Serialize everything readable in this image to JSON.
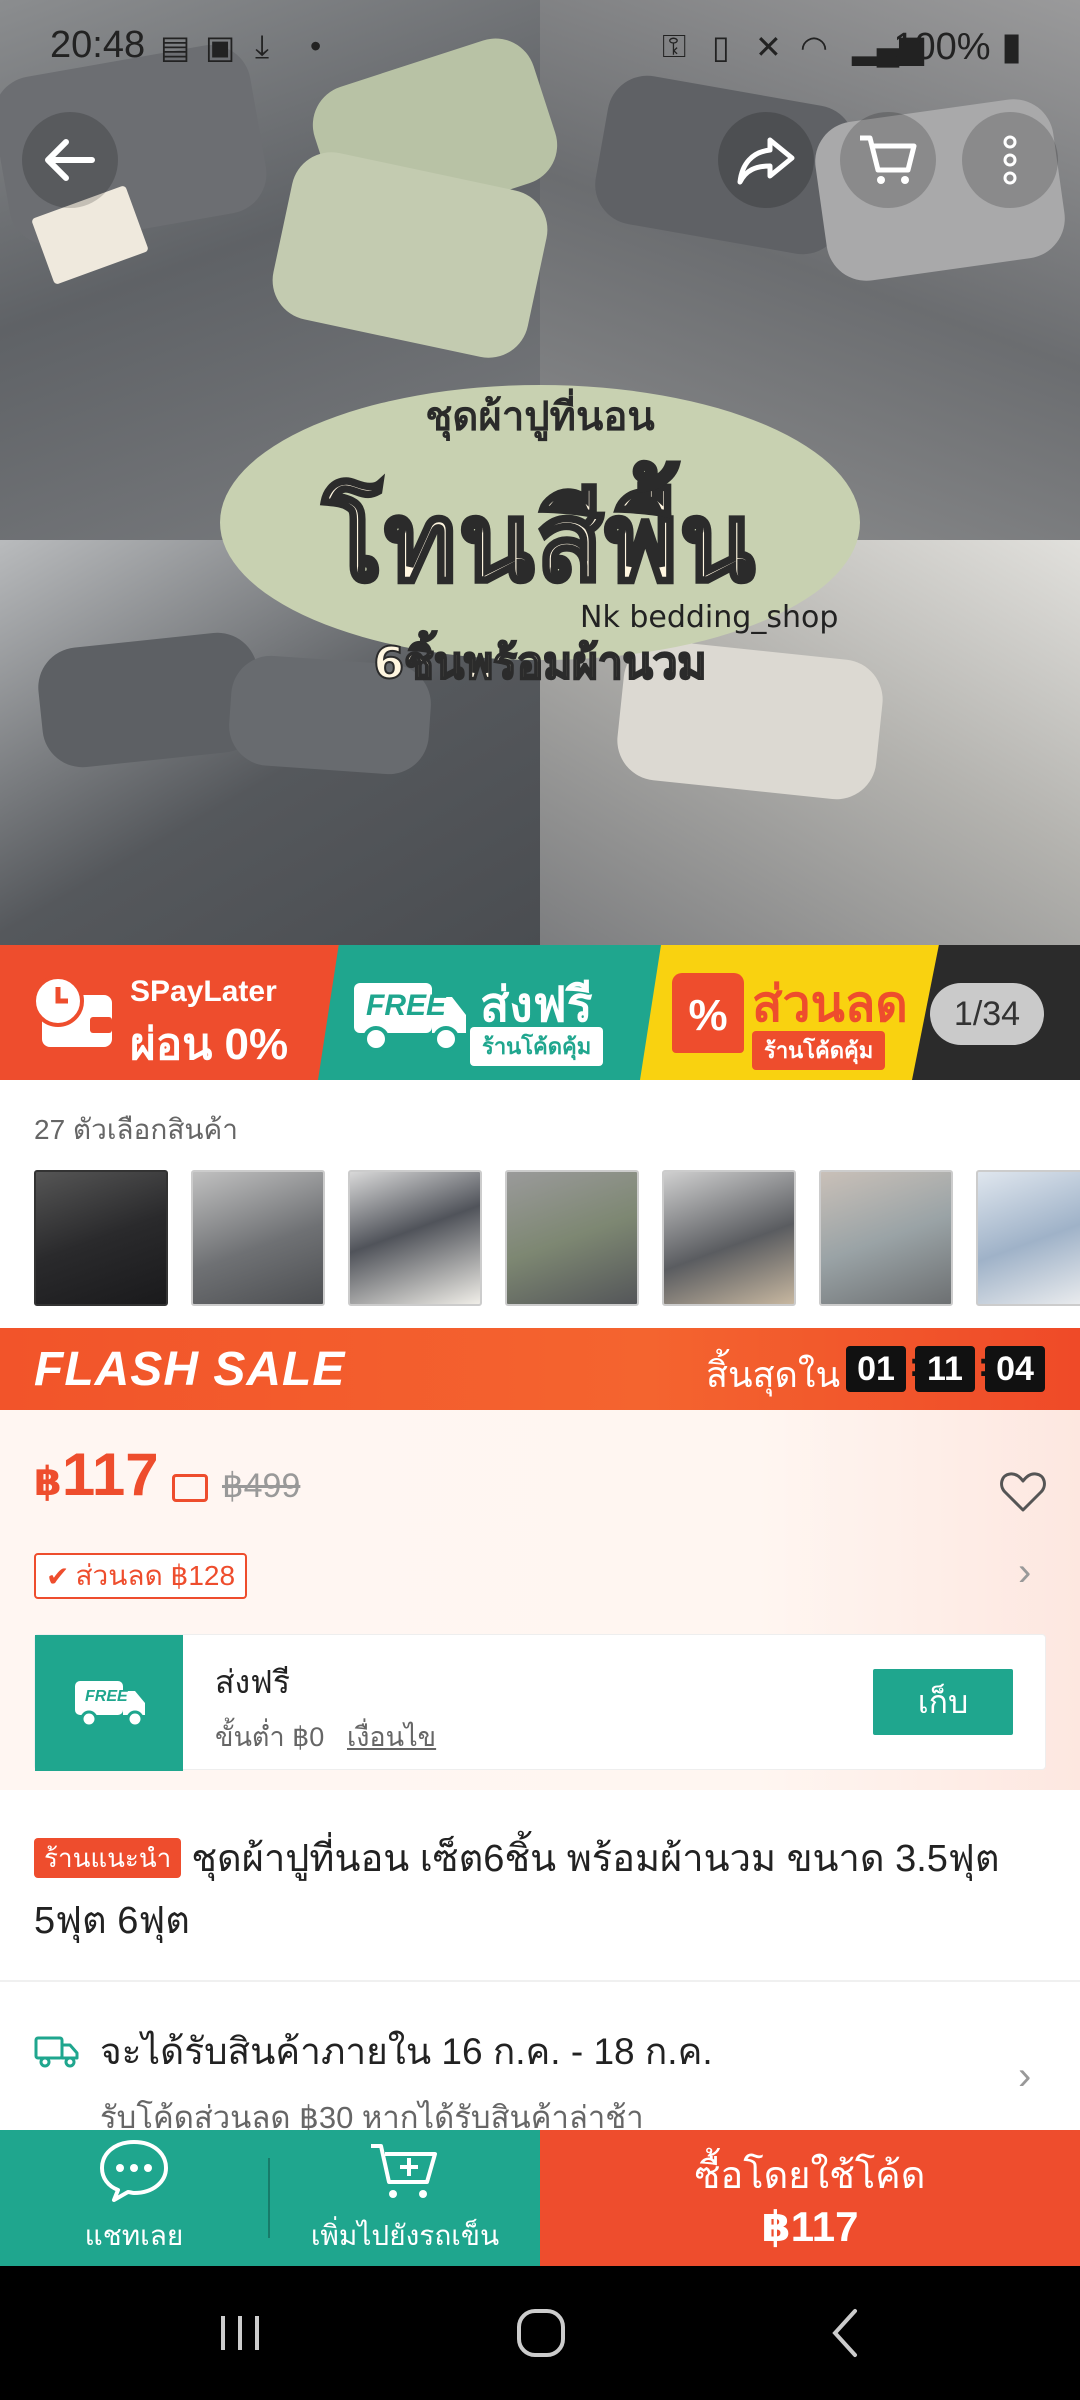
{
  "status_bar": {
    "time": "20:48",
    "battery": "100%"
  },
  "hero": {
    "line1": "ชุดผ้าปูที่นอน",
    "line2": "โทนสีพื้น",
    "shop": "Nk bedding_shop",
    "line3": "6ชิ้นพร้อมผ้านวม",
    "counter": "1/34"
  },
  "promo": {
    "spay_brand": "SPayLater",
    "spay_text": "ผ่อน 0%",
    "free_badge": "FREE",
    "free_text": "ส่งฟรี",
    "free_sub": "ร้านโค้ดคุ้ม",
    "disc_text": "ส่วนลด",
    "disc_sub": "ร้านโค้ดคุ้ม",
    "disc_symbol": "%"
  },
  "variants": {
    "label": "27 ตัวเลือกสินค้า",
    "thumb_colors": [
      "#2a2a2c",
      "#6f7174",
      "#50535a",
      "#7d8772",
      "#5a5c60",
      "#9aa3a6",
      "#9fb2c8"
    ]
  },
  "flash_sale": {
    "title": "FLASH SALE",
    "ends_in": "สิ้นสุดใน",
    "hours": "01",
    "minutes": "11",
    "seconds": "04"
  },
  "price": {
    "currency": "฿",
    "current": "117",
    "original": "฿499",
    "discount_tag": "ส่วนลด ฿128"
  },
  "shipping": {
    "badge": "FREE",
    "title": "ส่งฟรี",
    "min": "ขั้นต่ำ ฿0",
    "conditions": "เงื่อนไข",
    "collect": "เก็บ"
  },
  "product": {
    "badge": "ร้านแนะนำ",
    "title": "ชุดผ้าปูที่นอน เซ็ต6ชิ้น พร้อมผ้านวม ขนาด 3.5ฟุต 5ฟุต 6ฟุต"
  },
  "delivery": {
    "text": "จะได้รับสินค้าภายใน 16 ก.ค. - 18 ก.ค.",
    "sub": "รับโค้ดส่วนลด ฿30 หากได้รับสินค้าล่าช้า"
  },
  "bottom_bar": {
    "chat": "แชทเลย",
    "add_cart": "เพิ่มไปยังรถเข็น",
    "buy_title": "ซื้อโดยใช้โค้ด",
    "buy_price": "฿117"
  },
  "colors": {
    "shopee_orange": "#ee4d2d",
    "teal": "#1fa68e",
    "yellow": "#f9d210"
  }
}
